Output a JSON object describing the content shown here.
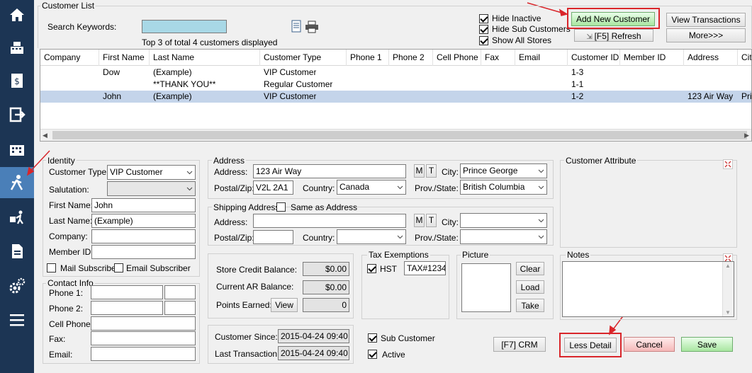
{
  "nav": {
    "items": [
      {
        "name": "home-icon"
      },
      {
        "name": "cash-register-icon"
      },
      {
        "name": "invoice-icon"
      },
      {
        "name": "exit-icon"
      },
      {
        "name": "building-icon"
      },
      {
        "name": "customer-icon",
        "active": true
      },
      {
        "name": "delivery-icon"
      },
      {
        "name": "report-icon"
      },
      {
        "name": "settings-icon"
      },
      {
        "name": "menu-icon"
      }
    ]
  },
  "list": {
    "title": "Customer List",
    "search_label": "Search Keywords:",
    "search_value": "",
    "count_text": "Top 3 of total 4 customers displayed",
    "hide_inactive": "Hide Inactive",
    "hide_sub": "Hide Sub Customers",
    "show_all": "Show All Stores",
    "add_new": "Add New Customer",
    "refresh": "[F5] Refresh",
    "view_transactions": "View Transactions",
    "more": "More>>>"
  },
  "grid": {
    "columns": [
      "Company",
      "First Name",
      "Last Name",
      "Customer Type",
      "Phone 1",
      "Phone 2",
      "Cell Phone",
      "Fax",
      "Email",
      "Customer ID",
      "Member ID",
      "Address",
      "City"
    ],
    "rows": [
      [
        "",
        "Dow",
        "(Example)",
        "VIP Customer",
        "",
        "",
        "",
        "",
        "",
        "1-3",
        "",
        "",
        ""
      ],
      [
        "",
        "",
        "**THANK YOU**",
        "Regular Customer",
        "",
        "",
        "",
        "",
        "",
        "1-1",
        "",
        "",
        ""
      ],
      [
        "",
        "John",
        "(Example)",
        "VIP Customer",
        "",
        "",
        "",
        "",
        "",
        "1-2",
        "",
        "123 Air Way",
        "Prin"
      ]
    ]
  },
  "identity": {
    "title": "Identity",
    "customer_type_label": "Customer Type:",
    "customer_type": "VIP Customer",
    "salutation_label": "Salutation:",
    "salutation": "",
    "first_name_label": "First Name:",
    "first_name": "John",
    "last_name_label": "Last Name:",
    "last_name": "(Example)",
    "company_label": "Company:",
    "company": "",
    "member_id_label": "Member ID:",
    "member_id": "",
    "mail_sub": "Mail Subscriber",
    "email_sub": "Email Subscriber"
  },
  "contact": {
    "title": "Contact Info",
    "phone1_label": "Phone 1:",
    "phone2_label": "Phone 2:",
    "cell_label": "Cell Phone:",
    "fax_label": "Fax:",
    "email_label": "Email:"
  },
  "address": {
    "title": "Address",
    "address_label": "Address:",
    "address": "123 Air Way",
    "m": "M",
    "t": "T",
    "city_label": "City:",
    "city": "Prince George",
    "postal_label": "Postal/Zip:",
    "postal": "V2L 2A1",
    "country_label": "Country:",
    "country": "Canada",
    "prov_label": "Prov./State:",
    "prov": "British Columbia"
  },
  "shipping": {
    "title": "Shipping Address",
    "same_as": "Same as Address",
    "address_label": "Address:",
    "city_label": "City:",
    "postal_label": "Postal/Zip:",
    "country_label": "Country:",
    "prov_label": "Prov./State:"
  },
  "balance": {
    "store_credit_label": "Store Credit Balance:",
    "store_credit": "$0.00",
    "ar_label": "Current AR Balance:",
    "ar": "$0.00",
    "points_label": "Points Earned:",
    "view": "View",
    "points": "0"
  },
  "dates": {
    "since_label": "Customer Since:",
    "since": "2015-04-24  09:40",
    "last_label": "Last Transaction:",
    "last": "2015-04-24  09:40"
  },
  "tax": {
    "title": "Tax Exemptions",
    "hst_label": "HST",
    "hst_value": "TAX#1234"
  },
  "picture": {
    "title": "Picture",
    "clear": "Clear",
    "load": "Load",
    "take": "Take"
  },
  "attr": {
    "title": "Customer Attribute"
  },
  "notes": {
    "title": "Notes"
  },
  "flags": {
    "sub_customer": "Sub Customer",
    "active": "Active"
  },
  "actions": {
    "crm": "[F7] CRM",
    "less_detail": "Less Detail",
    "cancel": "Cancel",
    "save": "Save"
  }
}
